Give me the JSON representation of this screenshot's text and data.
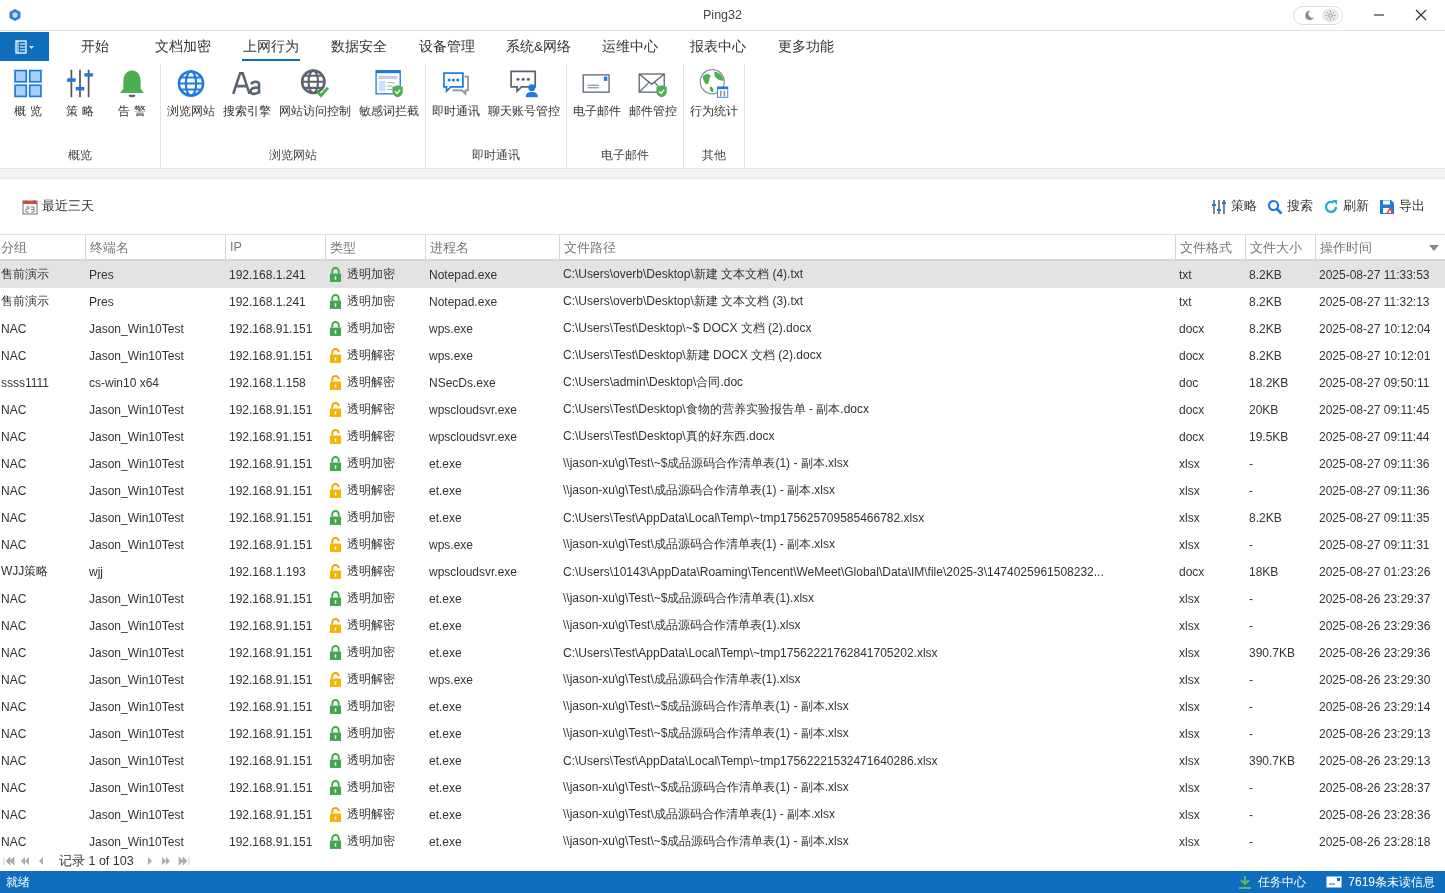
{
  "window": {
    "title": "Ping32",
    "dark_theme": false
  },
  "menu_tabs": [
    {
      "label": "开始",
      "selected": false
    },
    {
      "label": "文档加密",
      "selected": false
    },
    {
      "label": "上网行为",
      "selected": true
    },
    {
      "label": "数据安全",
      "selected": false
    },
    {
      "label": "设备管理",
      "selected": false
    },
    {
      "label": "系统&网络",
      "selected": false
    },
    {
      "label": "运维中心",
      "selected": false
    },
    {
      "label": "报表中心",
      "selected": false
    },
    {
      "label": "更多功能",
      "selected": false
    }
  ],
  "ribbon_groups": [
    {
      "label": "概览",
      "items": [
        "概 览",
        "策 略",
        "告 警"
      ]
    },
    {
      "label": "浏览网站",
      "items": [
        "浏览网站",
        "搜索引擎",
        "网站访问控制",
        "敏感词拦截"
      ]
    },
    {
      "label": "即时通讯",
      "items": [
        "即时通讯",
        "聊天账号管控"
      ]
    },
    {
      "label": "电子邮件",
      "items": [
        "电子邮件",
        "邮件管控"
      ]
    },
    {
      "label": "其他",
      "items": [
        "行为统计"
      ]
    }
  ],
  "toolbar": {
    "date_range": "最近三天",
    "actions": [
      "策略",
      "搜索",
      "刷新",
      "导出"
    ]
  },
  "table": {
    "columns": [
      "分组",
      "终端名",
      "IP",
      "类型",
      "进程名",
      "文件路径",
      "文件格式",
      "文件大小",
      "操作时间"
    ],
    "rows": [
      {
        "selected": true,
        "locked": true,
        "cells": [
          "售前演示",
          "Pres",
          "192.168.1.241",
          "透明加密",
          "Notepad.exe",
          "C:\\Users\\overb\\Desktop\\新建 文本文档 (4).txt",
          "txt",
          "8.2KB",
          "2025-08-27 11:33:53"
        ]
      },
      {
        "selected": false,
        "locked": true,
        "cells": [
          "售前演示",
          "Pres",
          "192.168.1.241",
          "透明加密",
          "Notepad.exe",
          "C:\\Users\\overb\\Desktop\\新建 文本文档 (3).txt",
          "txt",
          "8.2KB",
          "2025-08-27 11:32:13"
        ]
      },
      {
        "selected": false,
        "locked": true,
        "cells": [
          "NAC",
          "Jason_Win10Test",
          "192.168.91.151",
          "透明加密",
          "wps.exe",
          "C:\\Users\\Test\\Desktop\\~$ DOCX 文档 (2).docx",
          "docx",
          "8.2KB",
          "2025-08-27 10:12:04"
        ]
      },
      {
        "selected": false,
        "locked": false,
        "cells": [
          "NAC",
          "Jason_Win10Test",
          "192.168.91.151",
          "透明解密",
          "wps.exe",
          "C:\\Users\\Test\\Desktop\\新建 DOCX 文档 (2).docx",
          "docx",
          "8.2KB",
          "2025-08-27 10:12:01"
        ]
      },
      {
        "selected": false,
        "locked": false,
        "cells": [
          "ssss1111",
          "cs-win10 x64",
          "192.168.1.158",
          "透明解密",
          "NSecDs.exe",
          "C:\\Users\\admin\\Desktop\\合同.doc",
          "doc",
          "18.2KB",
          "2025-08-27 09:50:11"
        ]
      },
      {
        "selected": false,
        "locked": false,
        "cells": [
          "NAC",
          "Jason_Win10Test",
          "192.168.91.151",
          "透明解密",
          "wpscloudsvr.exe",
          "C:\\Users\\Test\\Desktop\\食物的营养实验报告单 - 副本.docx",
          "docx",
          "20KB",
          "2025-08-27 09:11:45"
        ]
      },
      {
        "selected": false,
        "locked": false,
        "cells": [
          "NAC",
          "Jason_Win10Test",
          "192.168.91.151",
          "透明解密",
          "wpscloudsvr.exe",
          "C:\\Users\\Test\\Desktop\\真的好东西.docx",
          "docx",
          "19.5KB",
          "2025-08-27 09:11:44"
        ]
      },
      {
        "selected": false,
        "locked": true,
        "cells": [
          "NAC",
          "Jason_Win10Test",
          "192.168.91.151",
          "透明加密",
          "et.exe",
          "\\\\jason-xu\\g\\Test\\~$成品源码合作清单表(1) - 副本.xlsx",
          "xlsx",
          "-",
          "2025-08-27 09:11:36"
        ]
      },
      {
        "selected": false,
        "locked": false,
        "cells": [
          "NAC",
          "Jason_Win10Test",
          "192.168.91.151",
          "透明解密",
          "et.exe",
          "\\\\jason-xu\\g\\Test\\成品源码合作清单表(1) - 副本.xlsx",
          "xlsx",
          "-",
          "2025-08-27 09:11:36"
        ]
      },
      {
        "selected": false,
        "locked": true,
        "cells": [
          "NAC",
          "Jason_Win10Test",
          "192.168.91.151",
          "透明加密",
          "et.exe",
          "C:\\Users\\Test\\AppData\\Local\\Temp\\~tmp175625709585466782.xlsx",
          "xlsx",
          "8.2KB",
          "2025-08-27 09:11:35"
        ]
      },
      {
        "selected": false,
        "locked": false,
        "cells": [
          "NAC",
          "Jason_Win10Test",
          "192.168.91.151",
          "透明解密",
          "wps.exe",
          "\\\\jason-xu\\g\\Test\\成品源码合作清单表(1) - 副本.xlsx",
          "xlsx",
          "-",
          "2025-08-27 09:11:31"
        ]
      },
      {
        "selected": false,
        "locked": false,
        "cells": [
          "WJJ策略",
          "wjj",
          "192.168.1.193",
          "透明解密",
          "wpscloudsvr.exe",
          "C:\\Users\\10143\\AppData\\Roaming\\Tencent\\WeMeet\\Global\\Data\\IM\\file\\2025-3\\1474025961508232...",
          "docx",
          "18KB",
          "2025-08-27 01:23:26"
        ]
      },
      {
        "selected": false,
        "locked": true,
        "cells": [
          "NAC",
          "Jason_Win10Test",
          "192.168.91.151",
          "透明加密",
          "et.exe",
          "\\\\jason-xu\\g\\Test\\~$成品源码合作清单表(1).xlsx",
          "xlsx",
          "-",
          "2025-08-26 23:29:37"
        ]
      },
      {
        "selected": false,
        "locked": false,
        "cells": [
          "NAC",
          "Jason_Win10Test",
          "192.168.91.151",
          "透明解密",
          "et.exe",
          "\\\\jason-xu\\g\\Test\\成品源码合作清单表(1).xlsx",
          "xlsx",
          "-",
          "2025-08-26 23:29:36"
        ]
      },
      {
        "selected": false,
        "locked": true,
        "cells": [
          "NAC",
          "Jason_Win10Test",
          "192.168.91.151",
          "透明加密",
          "et.exe",
          "C:\\Users\\Test\\AppData\\Local\\Temp\\~tmp17562221762841705202.xlsx",
          "xlsx",
          "390.7KB",
          "2025-08-26 23:29:36"
        ]
      },
      {
        "selected": false,
        "locked": false,
        "cells": [
          "NAC",
          "Jason_Win10Test",
          "192.168.91.151",
          "透明解密",
          "wps.exe",
          "\\\\jason-xu\\g\\Test\\成品源码合作清单表(1).xlsx",
          "xlsx",
          "-",
          "2025-08-26 23:29:30"
        ]
      },
      {
        "selected": false,
        "locked": true,
        "cells": [
          "NAC",
          "Jason_Win10Test",
          "192.168.91.151",
          "透明加密",
          "et.exe",
          "\\\\jason-xu\\g\\Test\\~$成品源码合作清单表(1) - 副本.xlsx",
          "xlsx",
          "-",
          "2025-08-26 23:29:14"
        ]
      },
      {
        "selected": false,
        "locked": true,
        "cells": [
          "NAC",
          "Jason_Win10Test",
          "192.168.91.151",
          "透明加密",
          "et.exe",
          "\\\\jason-xu\\g\\Test\\~$成品源码合作清单表(1) - 副本.xlsx",
          "xlsx",
          "-",
          "2025-08-26 23:29:13"
        ]
      },
      {
        "selected": false,
        "locked": true,
        "cells": [
          "NAC",
          "Jason_Win10Test",
          "192.168.91.151",
          "透明加密",
          "et.exe",
          "C:\\Users\\Test\\AppData\\Local\\Temp\\~tmp17562221532471640286.xlsx",
          "xlsx",
          "390.7KB",
          "2025-08-26 23:29:13"
        ]
      },
      {
        "selected": false,
        "locked": true,
        "cells": [
          "NAC",
          "Jason_Win10Test",
          "192.168.91.151",
          "透明加密",
          "et.exe",
          "\\\\jason-xu\\g\\Test\\~$成品源码合作清单表(1) - 副本.xlsx",
          "xlsx",
          "-",
          "2025-08-26 23:28:37"
        ]
      },
      {
        "selected": false,
        "locked": false,
        "cells": [
          "NAC",
          "Jason_Win10Test",
          "192.168.91.151",
          "透明解密",
          "et.exe",
          "\\\\jason-xu\\g\\Test\\成品源码合作清单表(1) - 副本.xlsx",
          "xlsx",
          "-",
          "2025-08-26 23:28:36"
        ]
      },
      {
        "selected": false,
        "locked": true,
        "cells": [
          "NAC",
          "Jason_Win10Test",
          "192.168.91.151",
          "透明加密",
          "et.exe",
          "\\\\jason-xu\\g\\Test\\~$成品源码合作清单表(1) - 副本.xlsx",
          "xlsx",
          "-",
          "2025-08-26 23:28:18"
        ]
      }
    ]
  },
  "pager": {
    "record": "记录 1 of 103"
  },
  "status_bar": {
    "status": "就绪",
    "tasks": "任务中心",
    "messages": "7619条未读信息"
  }
}
